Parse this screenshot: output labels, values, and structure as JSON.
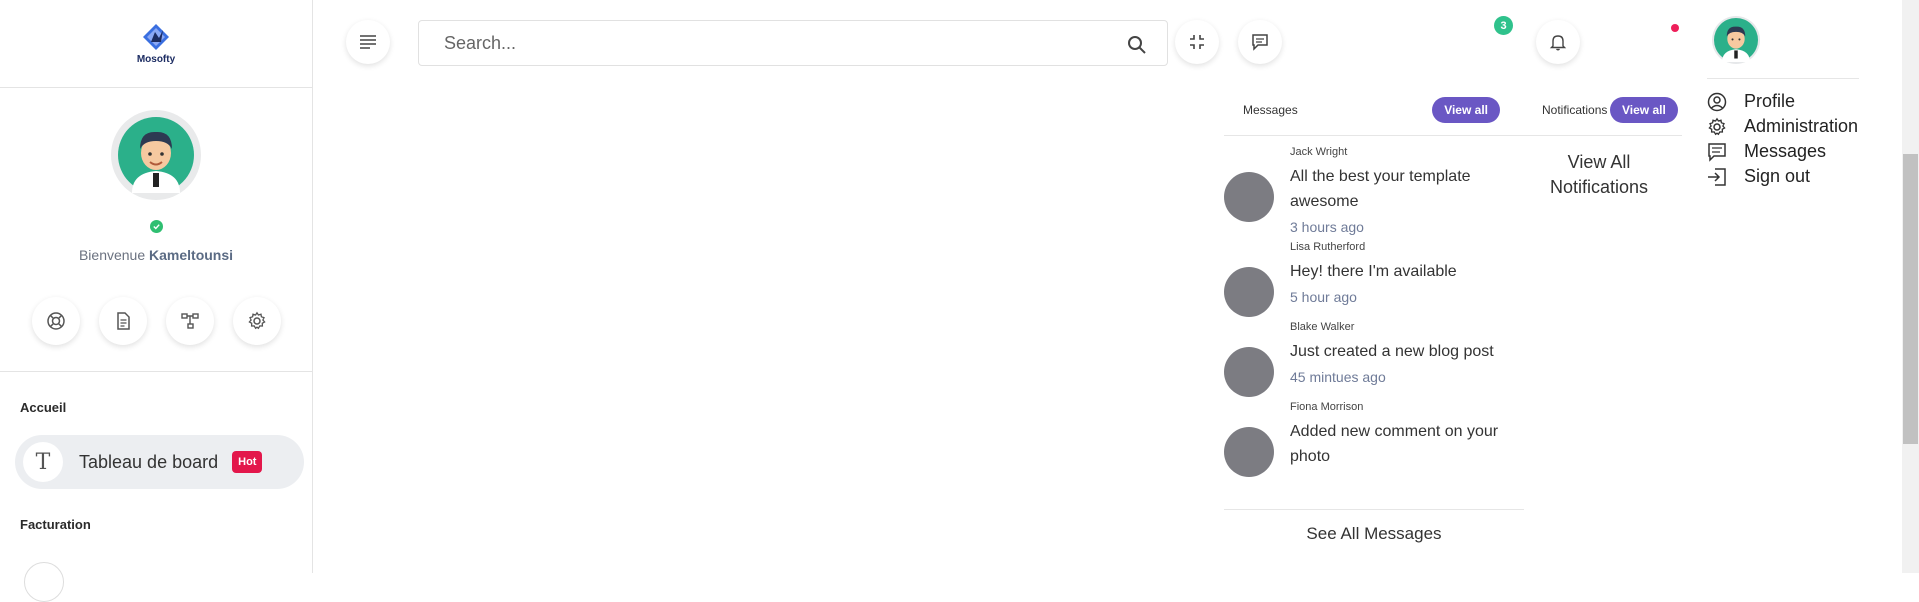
{
  "sidebar": {
    "logo_text": "Mosofty",
    "welcome_prefix": "Bienvenue",
    "username": "Kameltounsi",
    "quick_actions": [
      "support-icon",
      "document-icon",
      "hierarchy-icon",
      "settings-icon"
    ],
    "section_home": "Accueil",
    "menu_letter": "T",
    "menu_label": "Tableau de board",
    "menu_badge": "Hot",
    "section_billing": "Facturation"
  },
  "topbar": {
    "search_placeholder": "Search...",
    "message_count": "3"
  },
  "messages": {
    "title": "Messages",
    "view_all": "View all",
    "items": [
      {
        "name": "Jack Wright",
        "text": "All the best your template awesome",
        "time": "3 hours ago"
      },
      {
        "name": "Lisa Rutherford",
        "text": "Hey! there I'm available",
        "time": "5 hour ago"
      },
      {
        "name": "Blake Walker",
        "text": "Just created a new blog post",
        "time": "45 mintues ago"
      },
      {
        "name": "Fiona Morrison",
        "text": "Added new comment on your photo",
        "time": ""
      }
    ],
    "see_all": "See All Messages"
  },
  "notifications": {
    "title": "Notifications",
    "view_all": "View all",
    "view_all_text": "View All Notifications"
  },
  "profile_menu": {
    "items": [
      {
        "label": "Profile",
        "icon": "user-circle-icon"
      },
      {
        "label": "Administration",
        "icon": "gear-icon"
      },
      {
        "label": "Messages",
        "icon": "chat-icon"
      },
      {
        "label": "Sign out",
        "icon": "sign-out-icon"
      }
    ]
  },
  "colors": {
    "accent": "#6a57c4",
    "online": "#2fbf71",
    "hot": "#e3174b",
    "badge": "#2fc28c"
  }
}
